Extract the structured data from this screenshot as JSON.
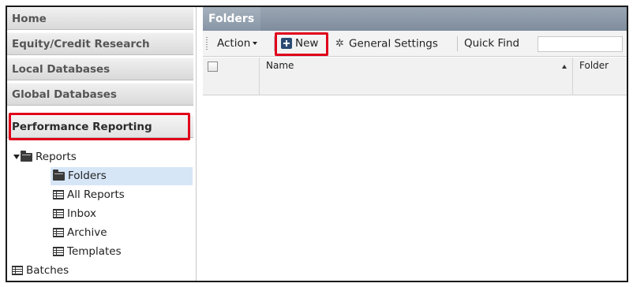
{
  "sidebar": {
    "nav": [
      {
        "label": "Home"
      },
      {
        "label": "Equity/Credit Research"
      },
      {
        "label": "Local Databases"
      },
      {
        "label": "Global Databases"
      },
      {
        "label": "Performance Reporting"
      }
    ],
    "tree": {
      "root": {
        "label": "Reports",
        "icon": "folder-icon"
      },
      "children": [
        {
          "label": "Folders",
          "icon": "folder-icon",
          "selected": true
        },
        {
          "label": "All Reports",
          "icon": "report-icon"
        },
        {
          "label": "Inbox",
          "icon": "report-icon"
        },
        {
          "label": "Archive",
          "icon": "report-icon"
        },
        {
          "label": "Templates",
          "icon": "report-icon"
        }
      ],
      "batches": {
        "label": "Batches",
        "icon": "report-icon"
      }
    }
  },
  "main": {
    "title": "Folders",
    "toolbar": {
      "action_label": "Action",
      "new_label": "New",
      "settings_label": "General Settings",
      "quick_find_label": "Quick Find",
      "quick_find_value": ""
    },
    "grid": {
      "columns": [
        "Name",
        "Folder"
      ]
    }
  },
  "colors": {
    "highlight": "#e0001b",
    "header": "#8795a5",
    "selected_row": "#d6e6f7"
  }
}
